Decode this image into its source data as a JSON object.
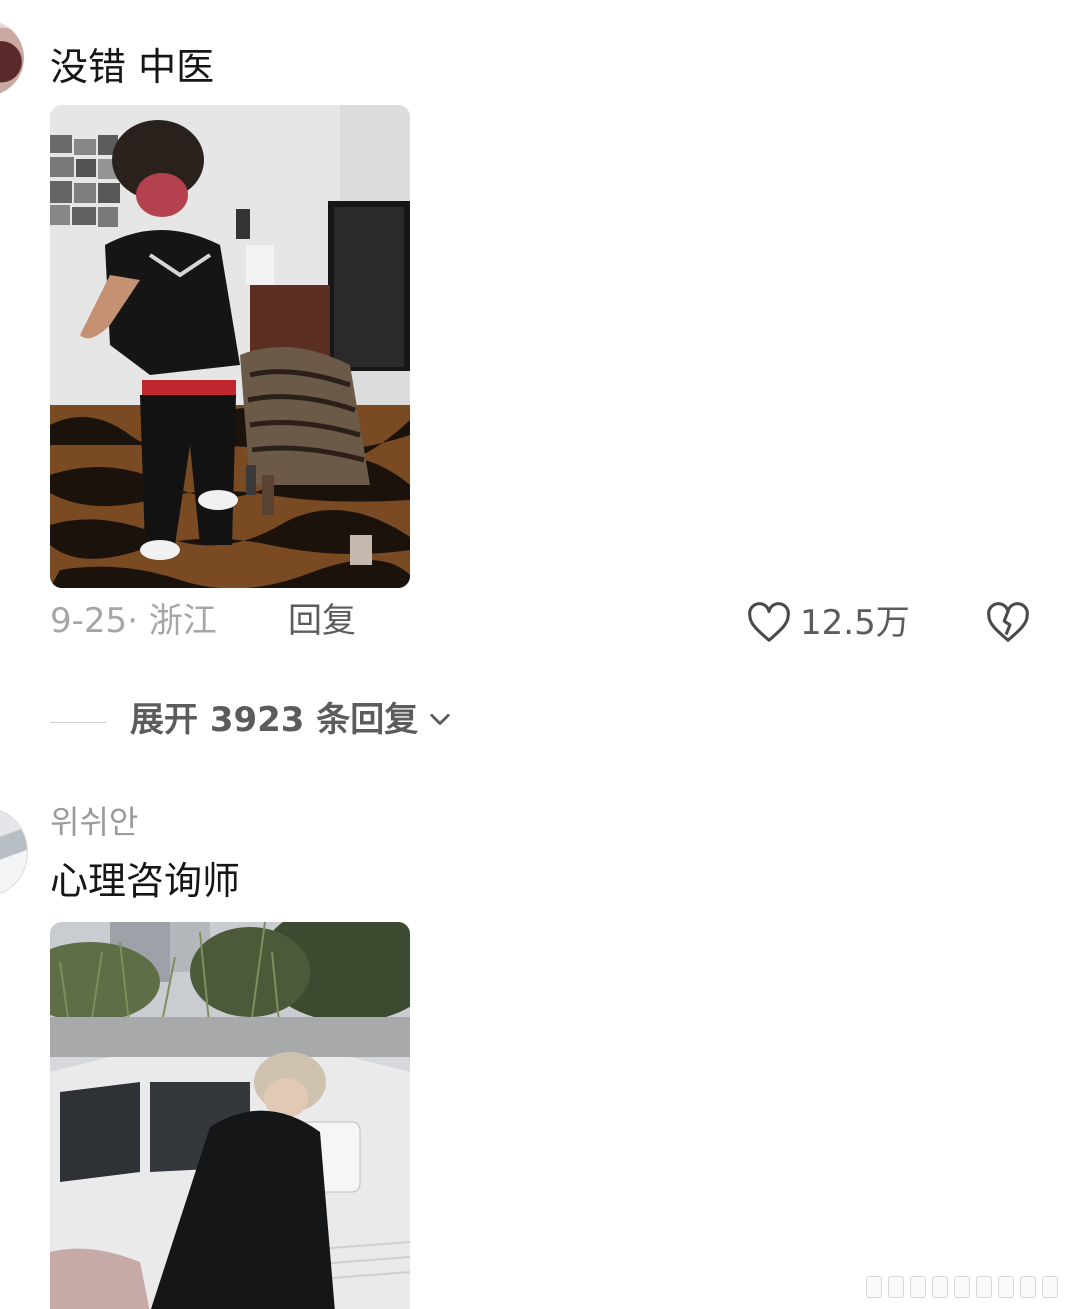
{
  "comments": [
    {
      "text": "没错 中医",
      "image_alt": "Person in black t-shirt with red belt and necklaces in a room with tiger-print rug",
      "meta": "9-25· 浙江",
      "reply_label": "回复",
      "like_count": "12.5万",
      "expand_label": "展开 3923 条回复"
    },
    {
      "username": "위쉬안",
      "text": "心理咨询师",
      "image_alt": "Person in black jacket walking beside a white car, trees in background"
    }
  ],
  "icons": {
    "like": "heart-outline-icon",
    "dislike": "broken-heart-icon",
    "expand": "chevron-down-icon"
  },
  "colors": {
    "primary_text": "#161616",
    "secondary_text": "#5c5c5c",
    "muted_text": "#a6a6a6"
  }
}
